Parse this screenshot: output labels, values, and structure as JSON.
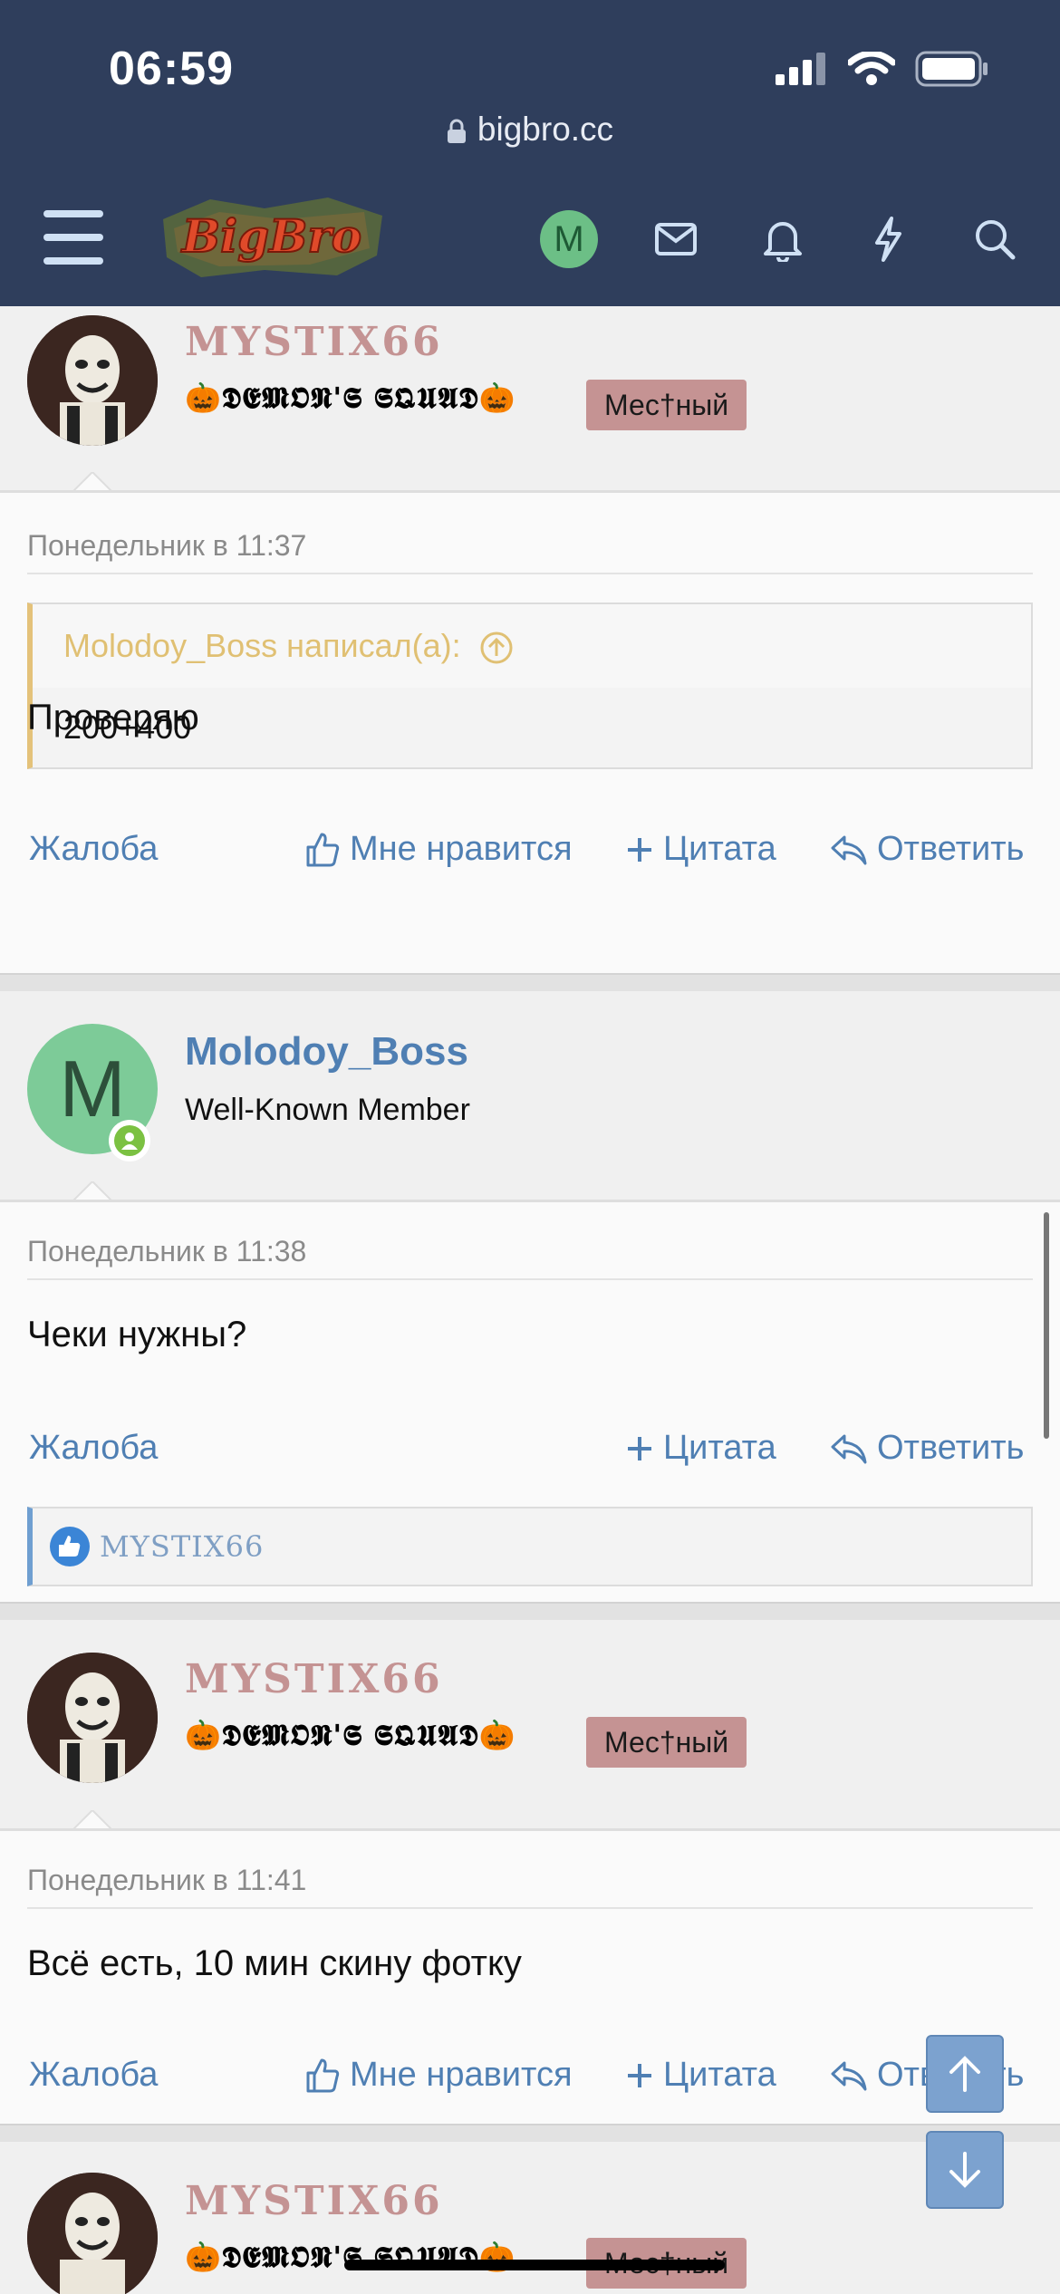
{
  "status_bar": {
    "time": "06:59"
  },
  "browser": {
    "url": "bigbro.cc"
  },
  "nav": {
    "logo_text": "BigBro",
    "user_initial": "M"
  },
  "posts": [
    {
      "username": "MYSTIX66",
      "squad": "🎃𝕯𝕰𝕸𝕺𝕹'𝕾 𝕾𝕼𝖀𝕬𝕯🎃",
      "badge": "Мес†ный",
      "date": "Понедельник в 11:37",
      "quote_author": "Molodoy_Boss написал(а):",
      "quote_text": "200+400",
      "message": "Проверяю",
      "actions": {
        "report": "Жалоба",
        "like": "Мне нравится",
        "quote": "Цитата",
        "reply": "Ответить"
      }
    },
    {
      "username": "Molodoy_Boss",
      "avatar_letter": "M",
      "title": "Well-Known Member",
      "date": "Понедельник в 11:38",
      "message": "Чеки нужны?",
      "actions": {
        "report": "Жалоба",
        "quote": "Цитата",
        "reply": "Ответить"
      },
      "liked_by": "MYSTIX66"
    },
    {
      "username": "MYSTIX66",
      "squad": "🎃𝕯𝕰𝕸𝕺𝕹'𝕾 𝕾𝕼𝖀𝕬𝕯🎃",
      "badge": "Мес†ный",
      "date": "Понедельник в 11:41",
      "message": "Всё есть, 10 мин скину фотку",
      "actions": {
        "report": "Жалоба",
        "like": "Мне нравится",
        "quote": "Цитата",
        "reply": "Ответить"
      }
    },
    {
      "username": "MYSTIX66",
      "squad": "🎃𝕯𝕰𝕸𝕺𝕹'𝕾 𝕾𝕼𝖀𝕬𝕯🎃",
      "badge": "Мес†ный"
    }
  ],
  "colors": {
    "header": "#2f3e5c",
    "link": "#4f7fb3",
    "username_mystix": "#c49393",
    "badge": "#c59393",
    "quote_accent": "#e4c27a"
  }
}
